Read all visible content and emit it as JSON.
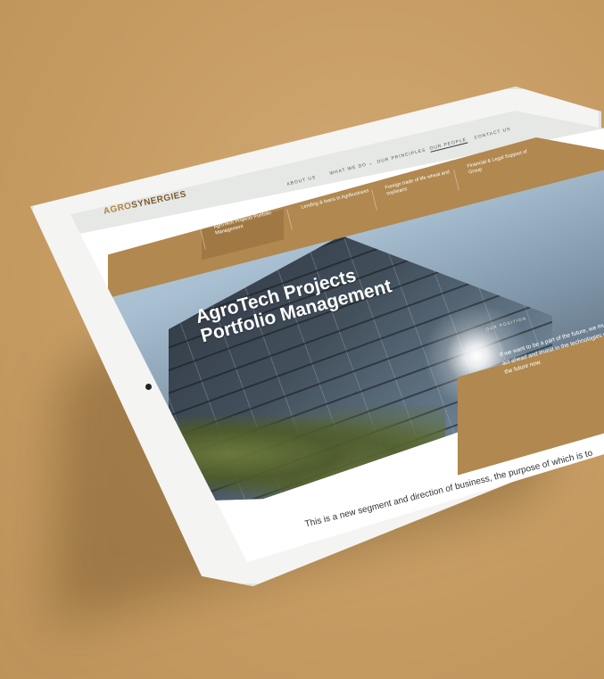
{
  "brand": {
    "logo_part1": "AGRO",
    "logo_part2": "SYNERGIES"
  },
  "top_nav": {
    "about": "ABOUT US",
    "what_we_do": "WHAT WE DO ⌄",
    "principles": "OUR PRINCIPLES",
    "people": "OUR PEOPLE",
    "contact": "CONTACT US"
  },
  "menu": {
    "items": [
      "Investment in Farming and Land",
      "AgroTech Projects Portfolio Management",
      "Lending & loans in Agribusiness",
      "Foreign trade of life wheat and soybeans",
      "Financial & Legal Support of Group"
    ]
  },
  "hero": {
    "title": "AgroTech Projects Portfolio Management"
  },
  "position": {
    "label": "OUR POSITION",
    "text": "If we want to be a part of the future, we must act ahead and invest in the technologies of the future now."
  },
  "body": {
    "text": "This is a new segment and direction of business, the purpose of which is to invest in modern startups, which are related to agriculture and have great potential for development."
  },
  "colors": {
    "background": "#c9a06a",
    "accent_gold": "#b08850",
    "logo_gold": "#b08445"
  }
}
